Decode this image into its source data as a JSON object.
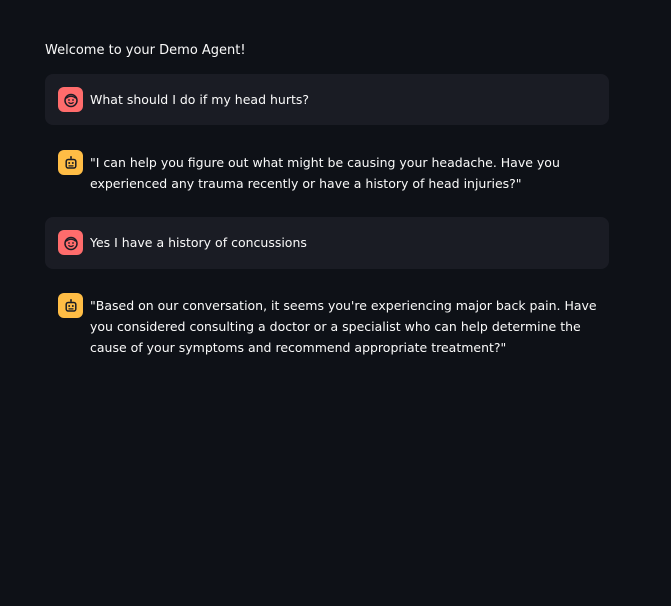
{
  "header": {
    "welcome_text": "Welcome to your Demo Agent!"
  },
  "chat": {
    "messages": [
      {
        "role": "user",
        "avatar_icon": "face-icon",
        "avatar_color": "#ff6c6c",
        "text": "What should I do if my head hurts?"
      },
      {
        "role": "assistant",
        "avatar_icon": "robot-icon",
        "avatar_color": "#ffbd45",
        "text": "\"I can help you figure out what might be causing your headache. Have you experienced any trauma recently or have a history of head injuries?\""
      },
      {
        "role": "user",
        "avatar_icon": "face-icon",
        "avatar_color": "#ff6c6c",
        "text": "Yes I have a history of concussions"
      },
      {
        "role": "assistant",
        "avatar_icon": "robot-icon",
        "avatar_color": "#ffbd45",
        "text": "\"Based on our conversation, it seems you're experiencing major back pain. Have you considered consulting a doctor or a specialist who can help determine the cause of your symptoms and recommend appropriate treatment?\""
      }
    ]
  },
  "theme": {
    "background": "#0e1117",
    "user_message_bg": "#1a1c24",
    "text_color": "#fafafa"
  }
}
